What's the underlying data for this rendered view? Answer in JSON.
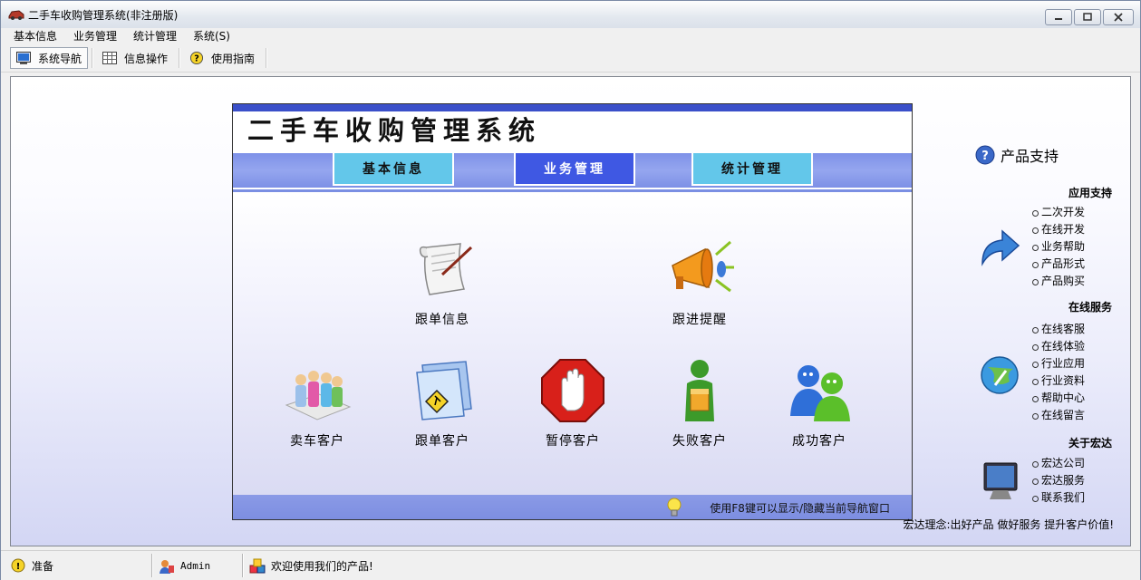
{
  "window": {
    "title": "二手车收购管理系统(非注册版)"
  },
  "menu": [
    "基本信息",
    "业务管理",
    "统计管理",
    "系统(S)"
  ],
  "toolbar": {
    "nav": "系统导航",
    "info": "信息操作",
    "guide": "使用指南"
  },
  "nav_panel": {
    "title": "二手车收购管理系统",
    "tabs": [
      "基本信息",
      "业务管理",
      "统计管理"
    ],
    "active_tab": "业务管理",
    "items": [
      "跟单信息",
      "跟进提醒",
      "卖车客户",
      "跟单客户",
      "暂停客户",
      "失败客户",
      "成功客户"
    ],
    "hint": "使用F8键可以显示/隐藏当前导航窗口"
  },
  "support": {
    "title": "产品支持",
    "sections": [
      {
        "heading": "应用支持",
        "links": [
          "二次开发",
          "在线开发",
          "业务帮助",
          "产品形式",
          "产品购买"
        ]
      },
      {
        "heading": "在线服务",
        "links": [
          "在线客服",
          "在线体验",
          "行业应用",
          "行业资料",
          "帮助中心",
          "在线留言"
        ]
      },
      {
        "heading": "关于宏达",
        "links": [
          "宏达公司",
          "宏达服务",
          "联系我们"
        ]
      }
    ],
    "motto": "宏达理念:出好产品 做好服务 提升客户价值!"
  },
  "statusbar": {
    "ready": "准备",
    "user": "Admin",
    "welcome": "欢迎使用我们的产品!"
  },
  "colors": {
    "accent": "#3f58e3",
    "tab": "#63c7ea",
    "tabbar": "#8a9ae6"
  }
}
